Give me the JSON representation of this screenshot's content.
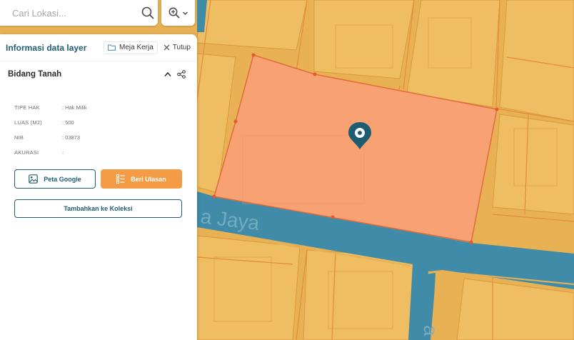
{
  "search": {
    "placeholder": "Cari Lokasi..."
  },
  "map": {
    "road_label": "a Jaya",
    "road_label_2": "a",
    "colors": {
      "parcel": "#e8b254",
      "parcel_light": "#efbd62",
      "selected": "#f8a274",
      "selected_border": "#e26b3e",
      "road": "#3f8ba8",
      "marker": "#1e5c72"
    }
  },
  "panel": {
    "title": "Informasi data layer",
    "workspace_label": "Meja Kerja",
    "close_label": "Tutup",
    "section_title": "Bidang Tanah",
    "attributes": [
      {
        "label": "TIPE HAK",
        "value": ": Hak Milik"
      },
      {
        "label": "LUAS (M2)",
        "value": ": 500"
      },
      {
        "label": "NIB",
        "value": ": 03873"
      },
      {
        "label": "AKURASI",
        "value": ":"
      }
    ],
    "buttons": {
      "google_maps": "Peta Google",
      "review": "Beri Ulasan",
      "add_collection": "Tambahkan ke Koleksi"
    }
  }
}
